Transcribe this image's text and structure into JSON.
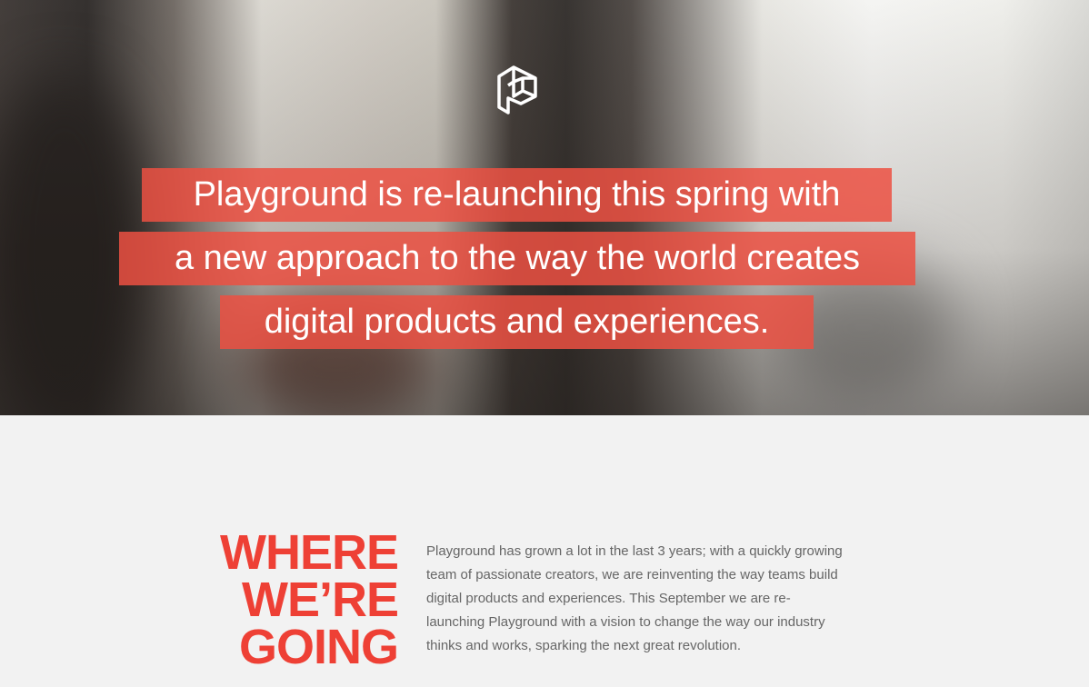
{
  "hero": {
    "logo": "playground-p-logo",
    "headline_lines": [
      "Playground is re-launching this spring with",
      "a new approach to the way the world creates",
      "digital products and experiences."
    ],
    "highlight_color": "#ec5042"
  },
  "section": {
    "heading_lines": [
      "WHERE",
      "WE’RE",
      "GOING"
    ],
    "heading_color": "#ee4035",
    "paragraph_lines": [
      "Playground has grown a lot in the last 3 years; with a quickly growing",
      "team of passionate creators, we are reinventing the way teams build",
      "digital products and experiences. This September we are re-",
      "launching Playground with a vision to change the way our industry",
      "thinks and works, sparking the next great revolution."
    ]
  }
}
